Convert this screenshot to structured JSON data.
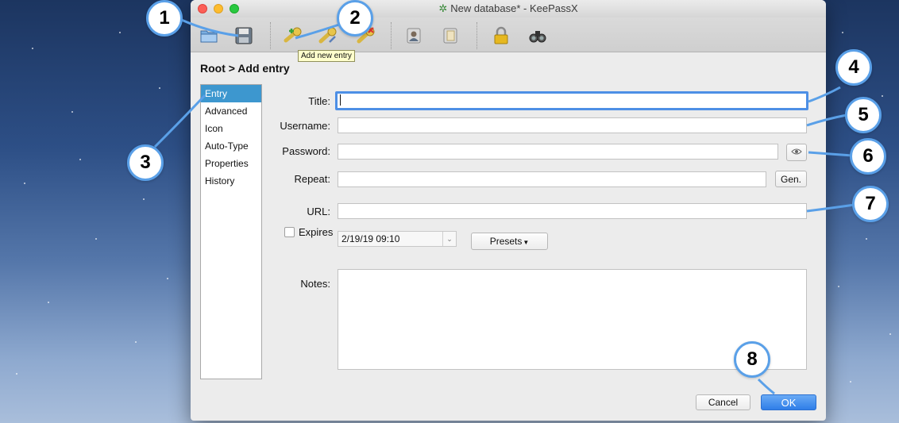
{
  "window": {
    "title": "New database* - KeePassX"
  },
  "toolbar": {
    "tooltip": "Add new entry",
    "buttons": [
      {
        "icon": "open-database-icon"
      },
      {
        "icon": "save-database-icon"
      },
      {
        "icon": "add-entry-icon"
      },
      {
        "icon": "edit-entry-icon"
      },
      {
        "icon": "delete-entry-icon"
      },
      {
        "icon": "copy-username-icon"
      },
      {
        "icon": "copy-password-icon"
      },
      {
        "icon": "lock-database-icon"
      },
      {
        "icon": "search-binoculars-icon"
      }
    ]
  },
  "breadcrumb": "Root > Add entry",
  "sidebar": {
    "items": [
      {
        "label": "Entry",
        "active": true
      },
      {
        "label": "Advanced"
      },
      {
        "label": "Icon"
      },
      {
        "label": "Auto-Type"
      },
      {
        "label": "Properties"
      },
      {
        "label": "History"
      }
    ]
  },
  "form": {
    "title_label": "Title:",
    "title_value": "",
    "username_label": "Username:",
    "username_value": "",
    "password_label": "Password:",
    "password_value": "",
    "repeat_label": "Repeat:",
    "repeat_value": "",
    "gen_button": "Gen.",
    "url_label": "URL:",
    "url_value": "",
    "expires_label": "Expires",
    "expires_checked": false,
    "expires_date": "2/19/19 09:10",
    "presets_button": "Presets",
    "notes_label": "Notes:",
    "notes_value": ""
  },
  "buttons": {
    "cancel": "Cancel",
    "ok": "OK"
  },
  "callouts": [
    "1",
    "2",
    "3",
    "4",
    "5",
    "6",
    "7",
    "8"
  ],
  "colors": {
    "accent": "#3d97cf",
    "focus": "#4d8fe5",
    "ok_button": "#2f7ee8",
    "callout_border": "#5aa0e8",
    "tooltip_bg": "#ffffcc"
  }
}
